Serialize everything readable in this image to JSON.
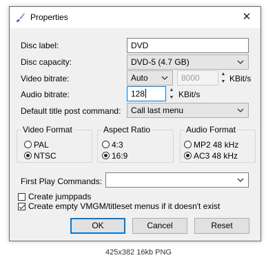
{
  "window": {
    "title": "Properties",
    "close_glyph": "✕"
  },
  "fields": {
    "disc_label": {
      "label": "Disc label:",
      "value": "DVD"
    },
    "disc_capacity": {
      "label": "Disc capacity:",
      "value": "DVD-5 (4.7 GB)"
    },
    "video_bitrate": {
      "label": "Video bitrate:",
      "mode": "Auto",
      "value": "8000",
      "unit": "KBit/s"
    },
    "audio_bitrate": {
      "label": "Audio bitrate:",
      "value": "128",
      "unit": "KBit/s"
    },
    "title_post": {
      "label": "Default title post command:",
      "value": "Call last menu"
    },
    "first_play": {
      "label": "First Play Commands:",
      "value": ""
    }
  },
  "groups": {
    "video_format": {
      "title": "Video Format",
      "options": [
        "PAL",
        "NTSC"
      ],
      "selected": "NTSC"
    },
    "aspect_ratio": {
      "title": "Aspect Ratio",
      "options": [
        "4:3",
        "16:9"
      ],
      "selected": "16:9"
    },
    "audio_format": {
      "title": "Audio Format",
      "options": [
        "MP2 48 kHz",
        "AC3 48 kHz"
      ],
      "selected": "AC3 48 kHz"
    }
  },
  "checkboxes": {
    "jumppads": {
      "label": "Create jumppads",
      "checked": false
    },
    "empty_vmgm": {
      "label": "Create empty VMGM/titleset menus if it doesn't exist",
      "checked": true
    }
  },
  "buttons": {
    "ok": "OK",
    "cancel": "Cancel",
    "reset": "Reset"
  },
  "caption": "425x382 16kb PNG",
  "icons": {
    "app": "brush-icon",
    "close": "close-icon",
    "dropdown": "chevron-down-icon"
  }
}
